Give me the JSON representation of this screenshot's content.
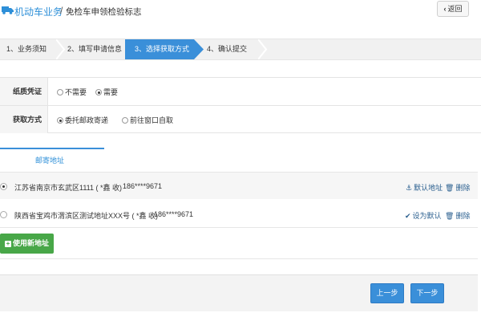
{
  "header": {
    "app_title": "机动车业务",
    "separator": "/",
    "page_title": "免检车申领检验标志",
    "back_label": "返回",
    "back_chevron": "‹"
  },
  "steps": [
    {
      "label": "1、业务须知",
      "active": false
    },
    {
      "label": "2、填写申请信息",
      "active": false
    },
    {
      "label": "3、选择获取方式",
      "active": true
    },
    {
      "label": "4、确认提交",
      "active": false
    }
  ],
  "form": {
    "paper_label": "纸质凭证",
    "paper_options": [
      {
        "label": "不需要",
        "selected": false
      },
      {
        "label": "需要",
        "selected": true
      }
    ],
    "method_label": "获取方式",
    "method_options": [
      {
        "label": "委托邮政寄递",
        "selected": true
      },
      {
        "label": "前往窗口自取",
        "selected": false
      }
    ]
  },
  "address_tab": {
    "label": "邮寄地址"
  },
  "addresses": [
    {
      "text": "江苏省南京市玄武区1111 ( *鑫 收)",
      "phone": "186****9671",
      "selected": true,
      "action_icon": "anchor-icon",
      "action_label": "默认地址",
      "delete_label": "删除"
    },
    {
      "text": "陕西省宝鸡市渭滨区测试地址XXX号 ( *鑫 收)",
      "phone": "186****9671",
      "selected": false,
      "action_icon": "check-icon",
      "action_label": "设为默认",
      "delete_label": "删除"
    }
  ],
  "new_address_label": "使用新地址",
  "footer": {
    "prev_label": "上一步",
    "next_label": "下一步"
  },
  "colors": {
    "accent": "#3a8fd9",
    "title_blue": "#2d8fd8",
    "success_green": "#48a748"
  }
}
